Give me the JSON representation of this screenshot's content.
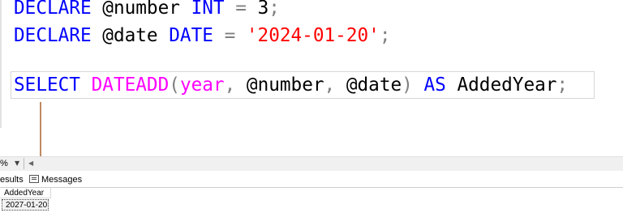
{
  "editor": {
    "line1": {
      "kw1": "DECLARE",
      "sp1": " ",
      "var": "@number",
      "sp2": " ",
      "type": "INT",
      "eq": " = ",
      "num": "3",
      "semi": ";"
    },
    "line2": {
      "kw1": "DECLARE",
      "sp1": " ",
      "var": "@date",
      "sp2": " ",
      "type": "DATE",
      "eq": " = ",
      "str": "'2024-01-20'",
      "semi": ";"
    },
    "line3": {
      "kw1": "SELECT",
      "sp1": " ",
      "fn": "DATEADD",
      "lp": "(",
      "arg1": "year",
      "c1": ", ",
      "arg2": "@number",
      "c2": ", ",
      "arg3": "@date",
      "rp": ")",
      "sp2": " ",
      "kw2": "AS",
      "alias": " AddedYear",
      "semi": ";"
    }
  },
  "status": {
    "zoom": "%",
    "zoom_caret": "▼",
    "scroll_left": "◀"
  },
  "tabs": {
    "results": "esults",
    "messages": "Messages"
  },
  "results_grid": {
    "columns": [
      "AddedYear"
    ],
    "rows": [
      [
        "2027-01-20"
      ]
    ]
  },
  "colors": {
    "keyword": "#0000ff",
    "function": "#ff00ff",
    "operator": "#808080",
    "string": "#ff0000",
    "arrow": "#c08a63"
  }
}
